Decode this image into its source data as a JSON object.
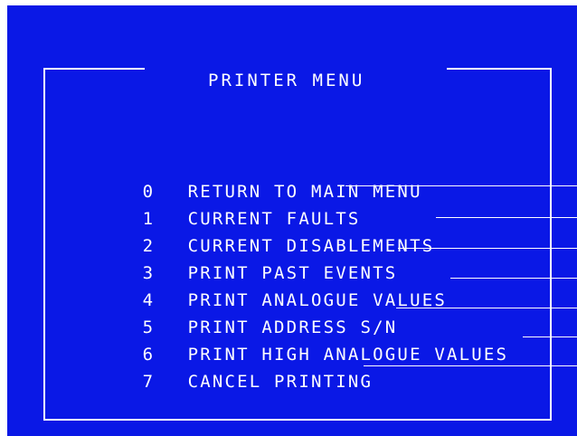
{
  "screen": {
    "background": "#0a18e6",
    "foreground": "#ffffff"
  },
  "menu": {
    "title": "PRINTER MENU",
    "items": [
      {
        "number": "0",
        "label": "RETURN TO MAIN MENU"
      },
      {
        "number": "1",
        "label": "CURRENT FAULTS"
      },
      {
        "number": "2",
        "label": "CURRENT DISABLEMENTS"
      },
      {
        "number": "3",
        "label": "PRINT PAST EVENTS"
      },
      {
        "number": "4",
        "label": "PRINT ANALOGUE VALUES"
      },
      {
        "number": "5",
        "label": "PRINT ADDRESS S/N"
      },
      {
        "number": "6",
        "label": "PRINT HIGH ANALOGUE VALUES"
      },
      {
        "number": "7",
        "label": "CANCEL PRINTING"
      }
    ]
  }
}
